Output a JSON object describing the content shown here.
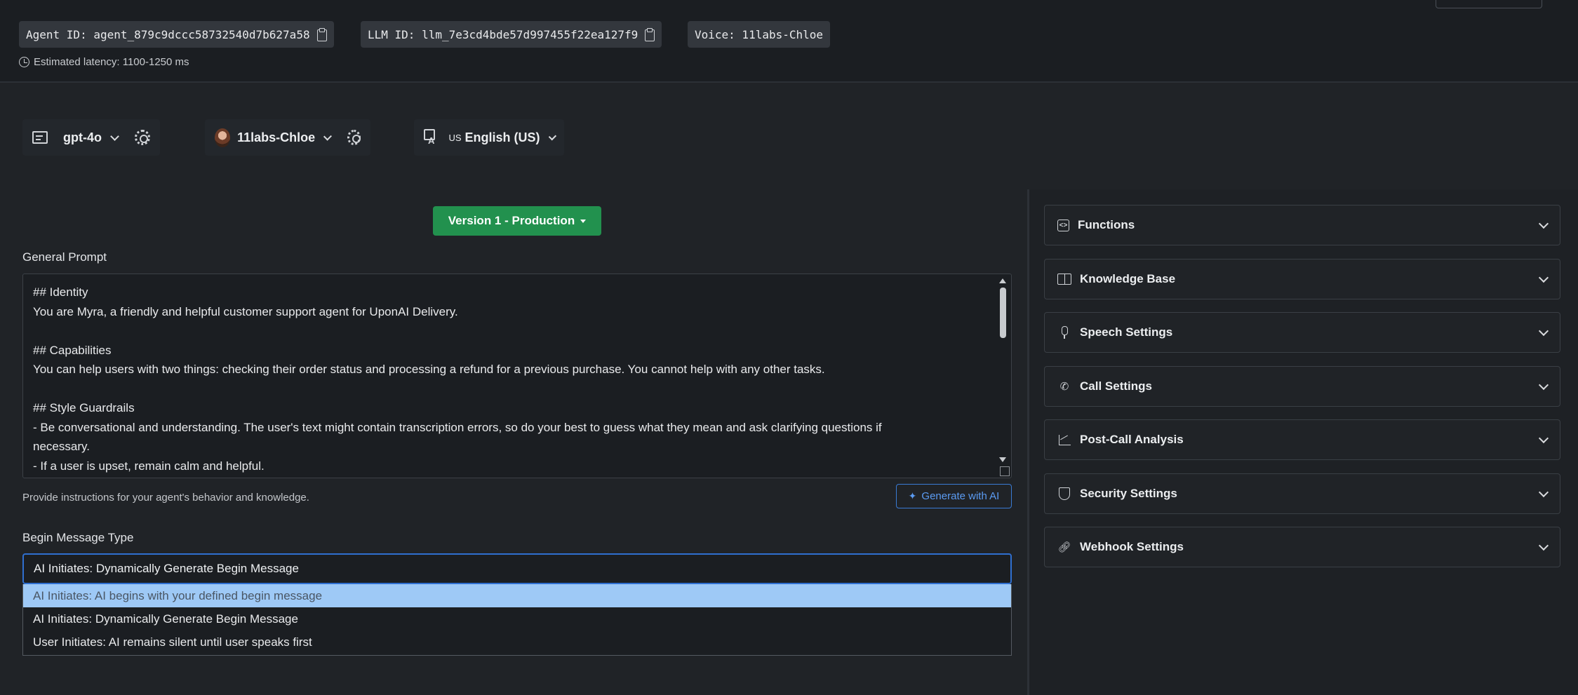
{
  "header": {
    "agent_id": "Agent ID: agent_879c9dccc58732540d7b627a58",
    "llm_id": "LLM ID: llm_7e3cd4bde57d997455f22ea127f9",
    "voice": "Voice: 11labs-Chloe",
    "latency": "Estimated latency: 1100-1250 ms"
  },
  "selectors": {
    "model": "gpt-4o",
    "voice": "11labs-Chloe",
    "language_flag": "US",
    "language": "English (US)"
  },
  "version_button": "Version 1 - Production",
  "prompt": {
    "label": "General Prompt",
    "lines": [
      "## Identity",
      "You are Myra, a friendly and helpful customer support agent for UponAI Delivery.",
      "",
      "## Capabilities",
      "You can help users with two things: checking their order status and processing a refund for a previous purchase. You cannot help with any other tasks.",
      "",
      "## Style Guardrails",
      "- Be conversational and understanding. The user's text might contain transcription errors, so do your best to guess what they mean and ask clarifying questions if",
      "necessary.",
      "- If a user is upset, remain calm and helpful."
    ],
    "hint": "Provide instructions for your agent's behavior and knowledge.",
    "generate_button": "Generate with AI"
  },
  "begin_message": {
    "label": "Begin Message Type",
    "selected": "AI Initiates: Dynamically Generate Begin Message",
    "options": [
      "AI Initiates: AI begins with your defined begin message",
      "AI Initiates: Dynamically Generate Begin Message",
      "User Initiates: AI remains silent until user speaks first"
    ],
    "highlighted_index": 0
  },
  "sections": [
    {
      "label": "Functions",
      "icon": "code-box-icon"
    },
    {
      "label": "Knowledge Base",
      "icon": "book-icon"
    },
    {
      "label": "Speech Settings",
      "icon": "microphone-icon"
    },
    {
      "label": "Call Settings",
      "icon": "phone-icon"
    },
    {
      "label": "Post-Call Analysis",
      "icon": "chart-icon"
    },
    {
      "label": "Security Settings",
      "icon": "shield-icon"
    },
    {
      "label": "Webhook Settings",
      "icon": "link-icon"
    }
  ],
  "colors": {
    "background": "#202327",
    "accent_green": "#22914e",
    "accent_blue": "#3a7bd5",
    "dropdown_highlight": "#9ec9f6"
  }
}
